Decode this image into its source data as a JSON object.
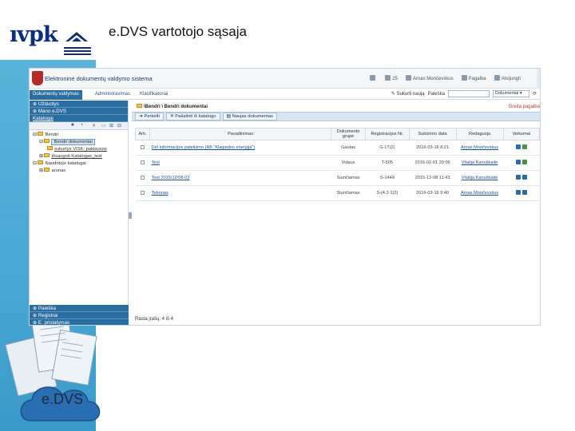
{
  "slide": {
    "title": "e.DVS vartotojo sąsaja",
    "logo_text": "ıvpk",
    "cloud_label": "e.DVS"
  },
  "app": {
    "name": "Elektroninė dokumentų valdymo sistema",
    "header": {
      "items": [
        {
          "icon": "settings-icon",
          "label": ""
        },
        {
          "icon": "mail-icon",
          "label": "25"
        },
        {
          "icon": "user-icon",
          "label": "Arnas Mončevskus"
        },
        {
          "icon": "help-icon",
          "label": "Pagalba"
        },
        {
          "icon": "power-icon",
          "label": "Atsijungti"
        }
      ]
    },
    "menu": {
      "tabs": [
        "Dokumentų valdymas",
        "Administravimas",
        "Klasifikatoriai"
      ],
      "create_label": "Sukurti naują",
      "search_label": "Paieška",
      "search_scope": "Dokumentai"
    },
    "left": {
      "nav_top": [
        "Užduotys",
        "Mano e.DVS",
        "Katalogai"
      ],
      "tree": [
        {
          "label": "Bendri",
          "level": 1
        },
        {
          "label": "Bendri dokumentai",
          "level": 2,
          "selected": true
        },
        {
          "label": "sukurtys VISK: paklausos",
          "level": 3
        },
        {
          "label": "Išsaugoti Katalogas_test",
          "level": 2
        },
        {
          "label": "Naudotojo katalogai",
          "level": 1
        },
        {
          "label": "arunas",
          "level": 2
        }
      ],
      "nav_bottom": [
        "Paieška",
        "Registrai",
        "E. pristatymas"
      ]
    },
    "right": {
      "breadcrumb": "\\Bendri \\ Bendri dokumentai",
      "quick_link": "Greita pagalba",
      "toolbar": [
        "Perkelti",
        "Pašalinti iš katalogo",
        "Naujas dokumentas"
      ],
      "table": {
        "headers": [
          "Arh.",
          "Pavadinimas",
          "Dokumento grupė",
          "Registracijos Nr.",
          "Sukūrimo data",
          "Redaguoja",
          "Veiksmai"
        ],
        "rows": [
          {
            "title": "Dėl informacijos pateikimo (AB \"Klaipėdos energija\")",
            "group": "Gautas",
            "reg": "G-1T(2)",
            "date": "2016-03-16 8:21",
            "editor": "Arnas Mončevskus"
          },
          {
            "title": "Test",
            "group": "Vidaus",
            "reg": "T-505",
            "date": "2016-02-01 20:06",
            "editor": "Vitalija Kanuškaitė"
          },
          {
            "title": "Test 2015/12/08-02",
            "group": "Siunčiamas",
            "reg": "S-1449",
            "date": "2015-12-08 11:43",
            "editor": "Vitalija Kanuškaitė"
          },
          {
            "title": "Tebonas",
            "group": "Siunčiamas",
            "reg": "S-(4.2-1(2)",
            "date": "2016-03-16 9:40",
            "editor": "Arnas Mončevskus"
          }
        ]
      },
      "total": "Rasta įrašų: 4 iš 4"
    }
  }
}
